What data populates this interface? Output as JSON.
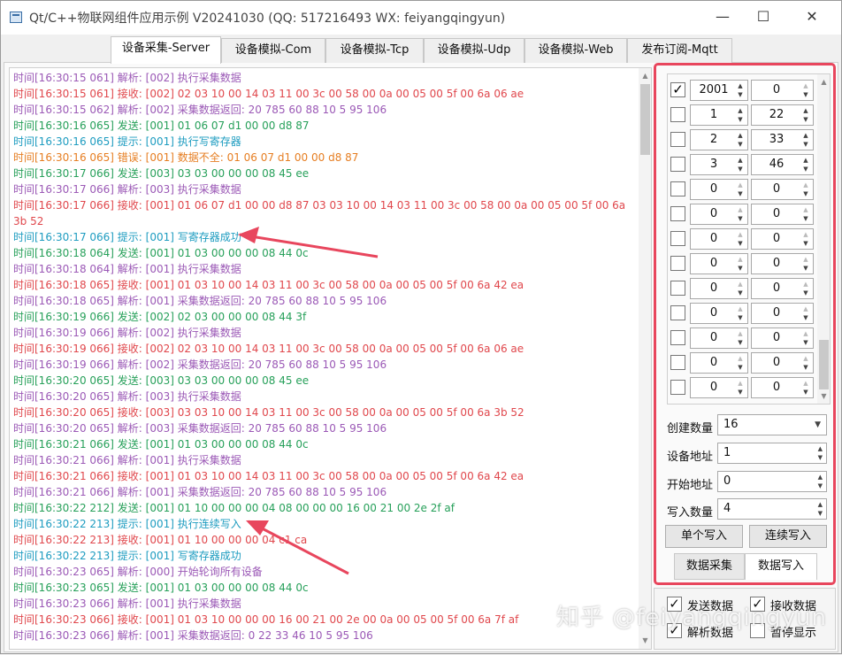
{
  "window": {
    "title": "Qt/C++物联网组件应用示例 V20241030 (QQ: 517216493 WX: feiyangqingyun)",
    "controls": {
      "minimize": "—",
      "maximize": "☐",
      "close": "✕"
    }
  },
  "tabs": [
    {
      "label": "设备采集-Server",
      "active": true
    },
    {
      "label": "设备模拟-Com",
      "active": false
    },
    {
      "label": "设备模拟-Tcp",
      "active": false
    },
    {
      "label": "设备模拟-Udp",
      "active": false
    },
    {
      "label": "设备模拟-Web",
      "active": false
    },
    {
      "label": "发布订阅-Mqtt",
      "active": false
    }
  ],
  "log_colors": {
    "解析": "#9b59b6",
    "接收": "#e0474c",
    "发送": "#27a05a",
    "提示": "#1e9cc0",
    "错误": "#e67e22"
  },
  "log": [
    {
      "type": "解析",
      "text": "时间[16:30:15 061] 解析: [002] 执行采集数据"
    },
    {
      "type": "接收",
      "text": "时间[16:30:15 061] 接收: [002] 02 03 10 00 14 03 11 00 3c 00 58 00 0a 00 05 00 5f 00 6a 06 ae"
    },
    {
      "type": "解析",
      "text": "时间[16:30:15 062] 解析: [002] 采集数据返回: 20 785 60 88 10 5 95 106"
    },
    {
      "type": "发送",
      "text": "时间[16:30:16 065] 发送: [001] 01 06 07 d1 00 00 d8 87"
    },
    {
      "type": "提示",
      "text": "时间[16:30:16 065] 提示: [001] 执行写寄存器"
    },
    {
      "type": "错误",
      "text": "时间[16:30:16 065] 错误: [001] 数据不全: 01 06 07 d1 00 00 d8 87"
    },
    {
      "type": "发送",
      "text": "时间[16:30:17 066] 发送: [003] 03 03 00 00 00 08 45 ee"
    },
    {
      "type": "解析",
      "text": "时间[16:30:17 066] 解析: [003] 执行采集数据"
    },
    {
      "type": "接收",
      "text": "时间[16:30:17 066] 接收: [001] 01 06 07 d1 00 00 d8 87 03 03 10 00 14 03 11 00 3c 00 58 00 0a 00 05 00 5f 00 6a 3b 52",
      "wrap": true
    },
    {
      "type": "提示",
      "text": "时间[16:30:17 066] 提示: [001] 写寄存器成功"
    },
    {
      "type": "发送",
      "text": "时间[16:30:18 064] 发送: [001] 01 03 00 00 00 08 44 0c"
    },
    {
      "type": "解析",
      "text": "时间[16:30:18 064] 解析: [001] 执行采集数据"
    },
    {
      "type": "接收",
      "text": "时间[16:30:18 065] 接收: [001] 01 03 10 00 14 03 11 00 3c 00 58 00 0a 00 05 00 5f 00 6a 42 ea"
    },
    {
      "type": "解析",
      "text": "时间[16:30:18 065] 解析: [001] 采集数据返回: 20 785 60 88 10 5 95 106"
    },
    {
      "type": "发送",
      "text": "时间[16:30:19 066] 发送: [002] 02 03 00 00 00 08 44 3f"
    },
    {
      "type": "解析",
      "text": "时间[16:30:19 066] 解析: [002] 执行采集数据"
    },
    {
      "type": "接收",
      "text": "时间[16:30:19 066] 接收: [002] 02 03 10 00 14 03 11 00 3c 00 58 00 0a 00 05 00 5f 00 6a 06 ae"
    },
    {
      "type": "解析",
      "text": "时间[16:30:19 066] 解析: [002] 采集数据返回: 20 785 60 88 10 5 95 106"
    },
    {
      "type": "发送",
      "text": "时间[16:30:20 065] 发送: [003] 03 03 00 00 00 08 45 ee"
    },
    {
      "type": "解析",
      "text": "时间[16:30:20 065] 解析: [003] 执行采集数据"
    },
    {
      "type": "接收",
      "text": "时间[16:30:20 065] 接收: [003] 03 03 10 00 14 03 11 00 3c 00 58 00 0a 00 05 00 5f 00 6a 3b 52"
    },
    {
      "type": "解析",
      "text": "时间[16:30:20 065] 解析: [003] 采集数据返回: 20 785 60 88 10 5 95 106"
    },
    {
      "type": "发送",
      "text": "时间[16:30:21 066] 发送: [001] 01 03 00 00 00 08 44 0c"
    },
    {
      "type": "解析",
      "text": "时间[16:30:21 066] 解析: [001] 执行采集数据"
    },
    {
      "type": "接收",
      "text": "时间[16:30:21 066] 接收: [001] 01 03 10 00 14 03 11 00 3c 00 58 00 0a 00 05 00 5f 00 6a 42 ea"
    },
    {
      "type": "解析",
      "text": "时间[16:30:21 066] 解析: [001] 采集数据返回: 20 785 60 88 10 5 95 106"
    },
    {
      "type": "发送",
      "text": "时间[16:30:22 212] 发送: [001] 01 10 00 00 00 04 08 00 00 00 16 00 21 00 2e 2f af"
    },
    {
      "type": "提示",
      "text": "时间[16:30:22 213] 提示: [001] 执行连续写入"
    },
    {
      "type": "接收",
      "text": "时间[16:30:22 213] 接收: [001] 01 10 00 00 00 04 c1 ca"
    },
    {
      "type": "提示",
      "text": "时间[16:30:22 213] 提示: [001] 写寄存器成功"
    },
    {
      "type": "解析",
      "text": "时间[16:30:23 065] 解析: [000] 开始轮询所有设备"
    },
    {
      "type": "发送",
      "text": "时间[16:30:23 065] 发送: [001] 01 03 00 00 00 08 44 0c"
    },
    {
      "type": "解析",
      "text": "时间[16:30:23 066] 解析: [001] 执行采集数据"
    },
    {
      "type": "接收",
      "text": "时间[16:30:23 066] 接收: [001] 01 03 10 00 00 00 16 00 21 00 2e 00 0a 00 05 00 5f 00 6a 7f af"
    },
    {
      "type": "解析",
      "text": "时间[16:30:23 066] 解析: [001] 采集数据返回: 0 22 33 46 10 5 95 106"
    }
  ],
  "register_grid": [
    {
      "checked": true,
      "address": "2001",
      "value": "0"
    },
    {
      "checked": false,
      "address": "1",
      "value": "22"
    },
    {
      "checked": false,
      "address": "2",
      "value": "33"
    },
    {
      "checked": false,
      "address": "3",
      "value": "46"
    },
    {
      "checked": false,
      "address": "0",
      "value": "0"
    },
    {
      "checked": false,
      "address": "0",
      "value": "0"
    },
    {
      "checked": false,
      "address": "0",
      "value": "0"
    },
    {
      "checked": false,
      "address": "0",
      "value": "0"
    },
    {
      "checked": false,
      "address": "0",
      "value": "0"
    },
    {
      "checked": false,
      "address": "0",
      "value": "0"
    },
    {
      "checked": false,
      "address": "0",
      "value": "0"
    },
    {
      "checked": false,
      "address": "0",
      "value": "0"
    },
    {
      "checked": false,
      "address": "0",
      "value": "0"
    }
  ],
  "form": {
    "create_count_label": "创建数量",
    "create_count_value": "16",
    "device_address_label": "设备地址",
    "device_address_value": "1",
    "start_address_label": "开始地址",
    "start_address_value": "0",
    "write_count_label": "写入数量",
    "write_count_value": "4"
  },
  "buttons": {
    "single_write": "单个写入",
    "continuous_write": "连续写入"
  },
  "subtabs": [
    {
      "label": "数据采集",
      "active": false
    },
    {
      "label": "数据写入",
      "active": true
    }
  ],
  "options": [
    {
      "label": "发送数据",
      "checked": true
    },
    {
      "label": "接收数据",
      "checked": true
    },
    {
      "label": "解析数据",
      "checked": true
    },
    {
      "label": "暂停显示",
      "checked": false
    }
  ],
  "accent_color": "#e8465d",
  "watermark": "知乎 @feiyangqingyun"
}
